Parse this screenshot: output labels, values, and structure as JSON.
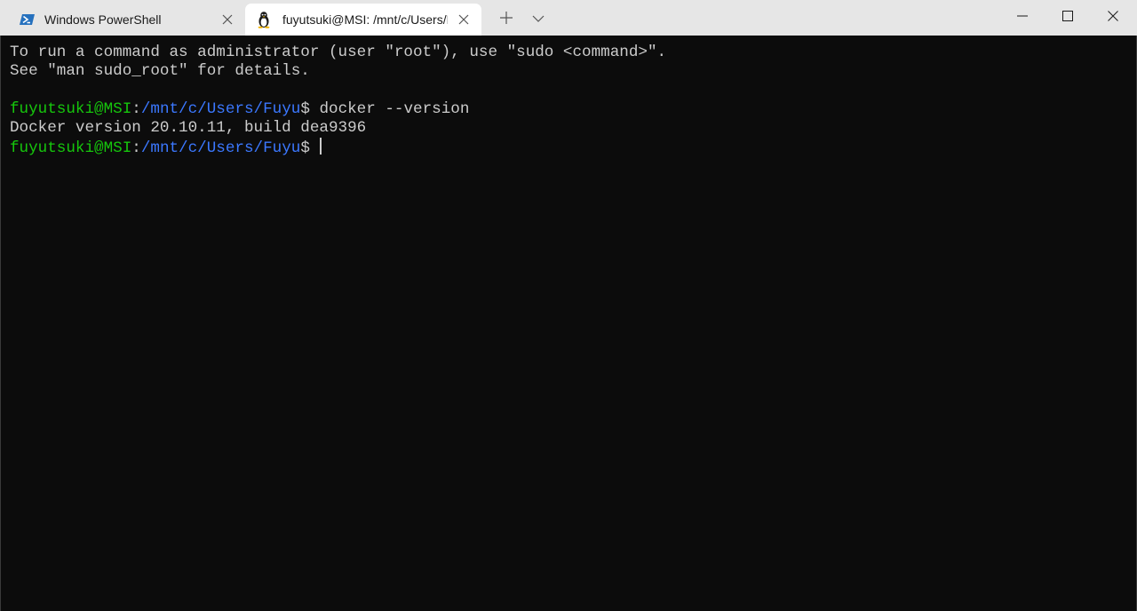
{
  "tabs": [
    {
      "label": "Windows PowerShell",
      "icon": "powershell-icon",
      "active": false
    },
    {
      "label": "fuyutsuki@MSI: /mnt/c/Users/Fuyu",
      "icon": "linux-penguin-icon",
      "active": true
    }
  ],
  "caption": {
    "minimize": "minimize",
    "maximize": "maximize",
    "close": "close"
  },
  "terminal": {
    "lines": [
      "To run a command as administrator (user \"root\"), use \"sudo <command>\".",
      "See \"man sudo_root\" for details."
    ],
    "prompt1": {
      "user": "fuyutsuki@MSI",
      "sep": ":",
      "path": "/mnt/c/Users/Fuyu",
      "symbol": "$ ",
      "command": "docker --version"
    },
    "output": "Docker version 20.10.11, build dea9396",
    "prompt2": {
      "user": "fuyutsuki@MSI",
      "sep": ":",
      "path": "/mnt/c/Users/Fuyu",
      "symbol": "$ "
    }
  },
  "colors": {
    "titlebar": "#e6e6e6",
    "active_tab": "#ffffff",
    "terminal_bg": "#0c0c0c",
    "terminal_fg": "#cccccc",
    "prompt_user": "#16c60c",
    "prompt_path": "#3b78ff"
  }
}
